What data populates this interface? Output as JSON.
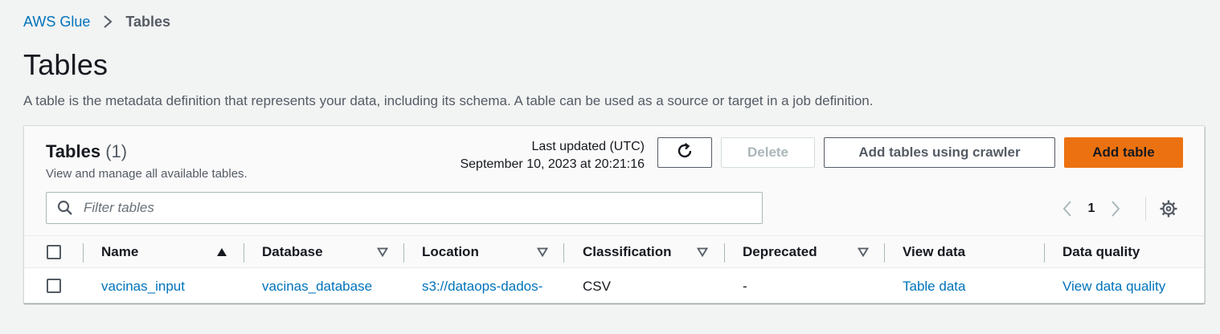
{
  "breadcrumb": {
    "items": [
      {
        "label": "AWS Glue"
      },
      {
        "label": "Tables"
      }
    ]
  },
  "page": {
    "title": "Tables",
    "description": "A table is the metadata definition that represents your data, including its schema. A table can be used as a source or target in a job definition."
  },
  "panel": {
    "heading": "Tables",
    "count": "(1)",
    "subheading": "View and manage all available tables.",
    "last_updated_label": "Last updated (UTC)",
    "last_updated_value": "September 10, 2023 at 20:21:16",
    "buttons": {
      "delete": "Delete",
      "add_crawler": "Add tables using crawler",
      "add_table": "Add table"
    },
    "filter_placeholder": "Filter tables",
    "pagination": {
      "current_page": "1"
    }
  },
  "table": {
    "columns": [
      {
        "label": "Name",
        "sort": "ascending"
      },
      {
        "label": "Database",
        "sort": "none"
      },
      {
        "label": "Location",
        "sort": "none"
      },
      {
        "label": "Classification",
        "sort": "none"
      },
      {
        "label": "Deprecated",
        "sort": "none"
      },
      {
        "label": "View data"
      },
      {
        "label": "Data quality"
      }
    ],
    "rows": [
      {
        "name": "vacinas_input",
        "database": "vacinas_database",
        "location": "s3://dataops-dados-",
        "classification": "CSV",
        "deprecated": "-",
        "view_data": "Table data",
        "data_quality": "View data quality"
      }
    ]
  },
  "colors": {
    "link": "#0073bb",
    "primary_button": "#ec7211",
    "background": "#f2f3f3"
  },
  "icons": [
    "chevron-right-icon",
    "refresh-icon",
    "search-icon",
    "chevron-left-icon",
    "gear-icon",
    "sort-ascending-icon",
    "sort-descending-icon"
  ]
}
